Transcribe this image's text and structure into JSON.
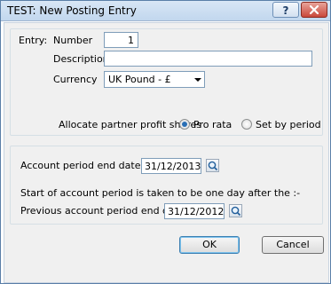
{
  "window": {
    "title": "TEST: New Posting Entry"
  },
  "titlebar": {
    "help_icon": "question-mark-icon",
    "close_icon": "close-x-icon"
  },
  "entry": {
    "group_label": "Entry:",
    "number_label": "Number",
    "number_value": "1",
    "description_label": "Description",
    "description_value": "",
    "currency_label": "Currency",
    "currency_value": "UK Pound - £",
    "allocate_label": "Allocate partner profit shares",
    "option_pro_rata": "Pro rata",
    "option_set_by_period": "Set by period",
    "selected_option": "Pro rata"
  },
  "period": {
    "end_date_label": "Account period end date",
    "end_date_value": "31/12/2013",
    "note": "Start of account period is taken to be one day after the :-",
    "prev_end_date_label": "Previous account period end date",
    "prev_end_date_value": "31/12/2012",
    "calendar_icon": "calendar-lookup-icon"
  },
  "buttons": {
    "ok": "OK",
    "cancel": "Cancel"
  }
}
